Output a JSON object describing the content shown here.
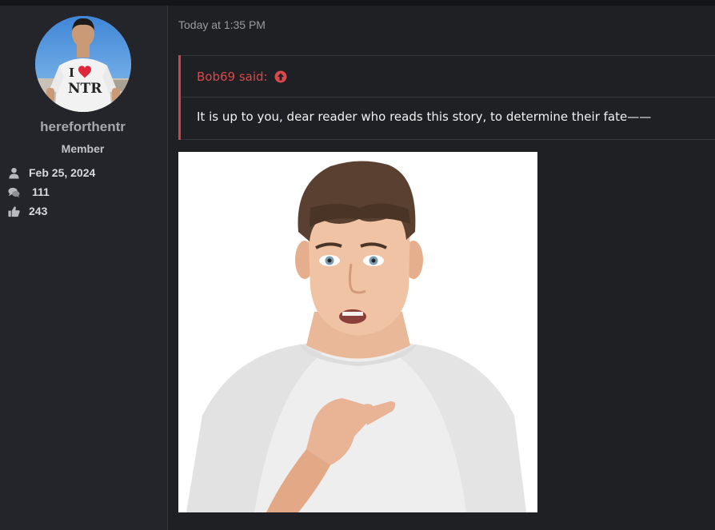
{
  "user": {
    "username": "hereforthentr",
    "title": "Member",
    "avatar_icon": "avatar-photo",
    "avatar_shirt_text": "I ♥ NTR",
    "stats": {
      "joined": "Feb 25, 2024",
      "messages": "111",
      "reactions": "243"
    },
    "stat_icons": [
      "user-icon",
      "comments-icon",
      "thumbs-up-icon"
    ]
  },
  "post": {
    "timestamp": "Today at 1:35 PM",
    "quote": {
      "author_label": "Bob69 said:",
      "jump_icon": "arrow-up-circle-icon",
      "text": "It is up to you, dear reader who reads this story, to determine their fate——"
    },
    "attachment_icon": "image-teen-pointing-at-self"
  },
  "colors": {
    "background": "#1f2024",
    "sidebar": "#24252a",
    "quote_accent": "#c8474b",
    "quote_author": "#d9484b",
    "muted_text": "#9a9ba0"
  }
}
